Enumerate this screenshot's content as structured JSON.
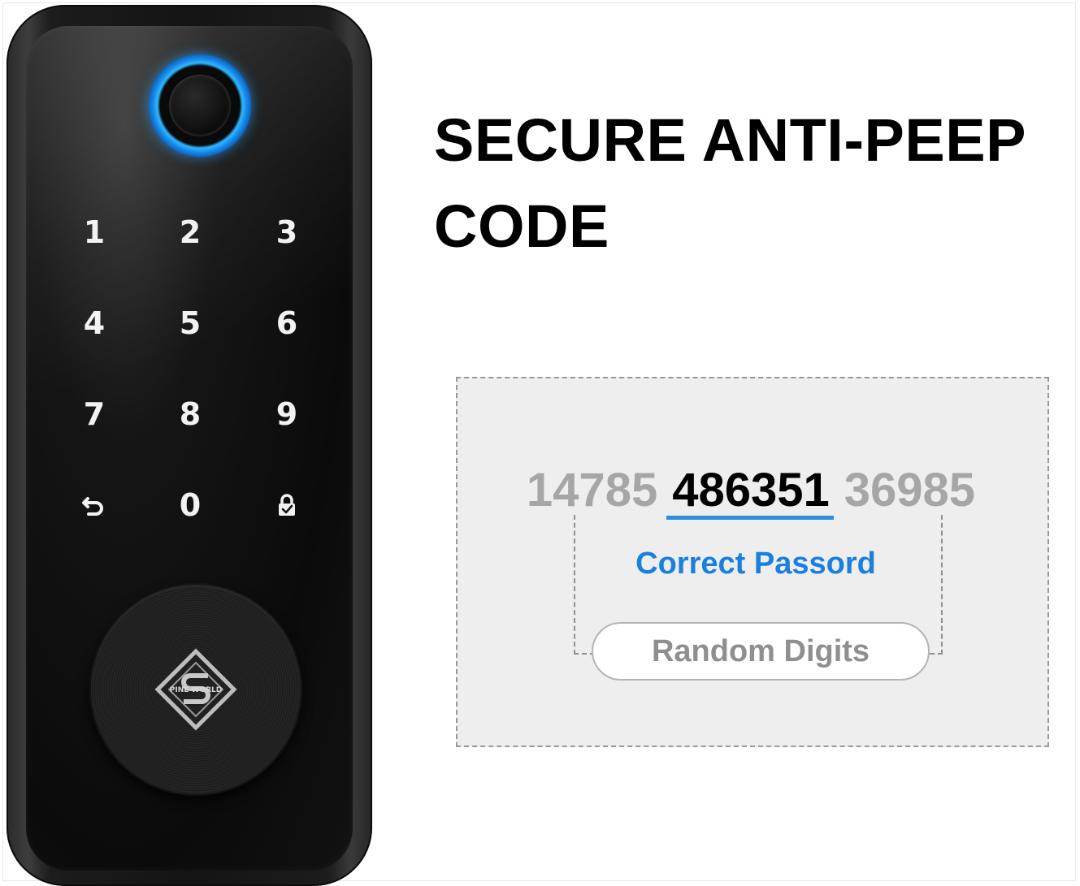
{
  "headline": {
    "line1": "SECURE ANTI-PEEP",
    "line2": "CODE"
  },
  "keypad": {
    "keys": [
      "1",
      "2",
      "3",
      "4",
      "5",
      "6",
      "7",
      "8",
      "9",
      "",
      "0",
      ""
    ],
    "back_icon": "back-arrow-icon",
    "lock_icon": "lock-check-icon"
  },
  "fingerprint": {
    "ring_color": "#1e9bf0"
  },
  "logo": {
    "text": "PINE WORLD"
  },
  "diagram": {
    "codes": {
      "random_before": "14785",
      "correct": "486351",
      "random_after": "36985"
    },
    "correct_label": "Correct Passord",
    "random_label": "Random Digits",
    "accent_color": "#1a7fe0",
    "muted_color": "#a6a6a6"
  }
}
